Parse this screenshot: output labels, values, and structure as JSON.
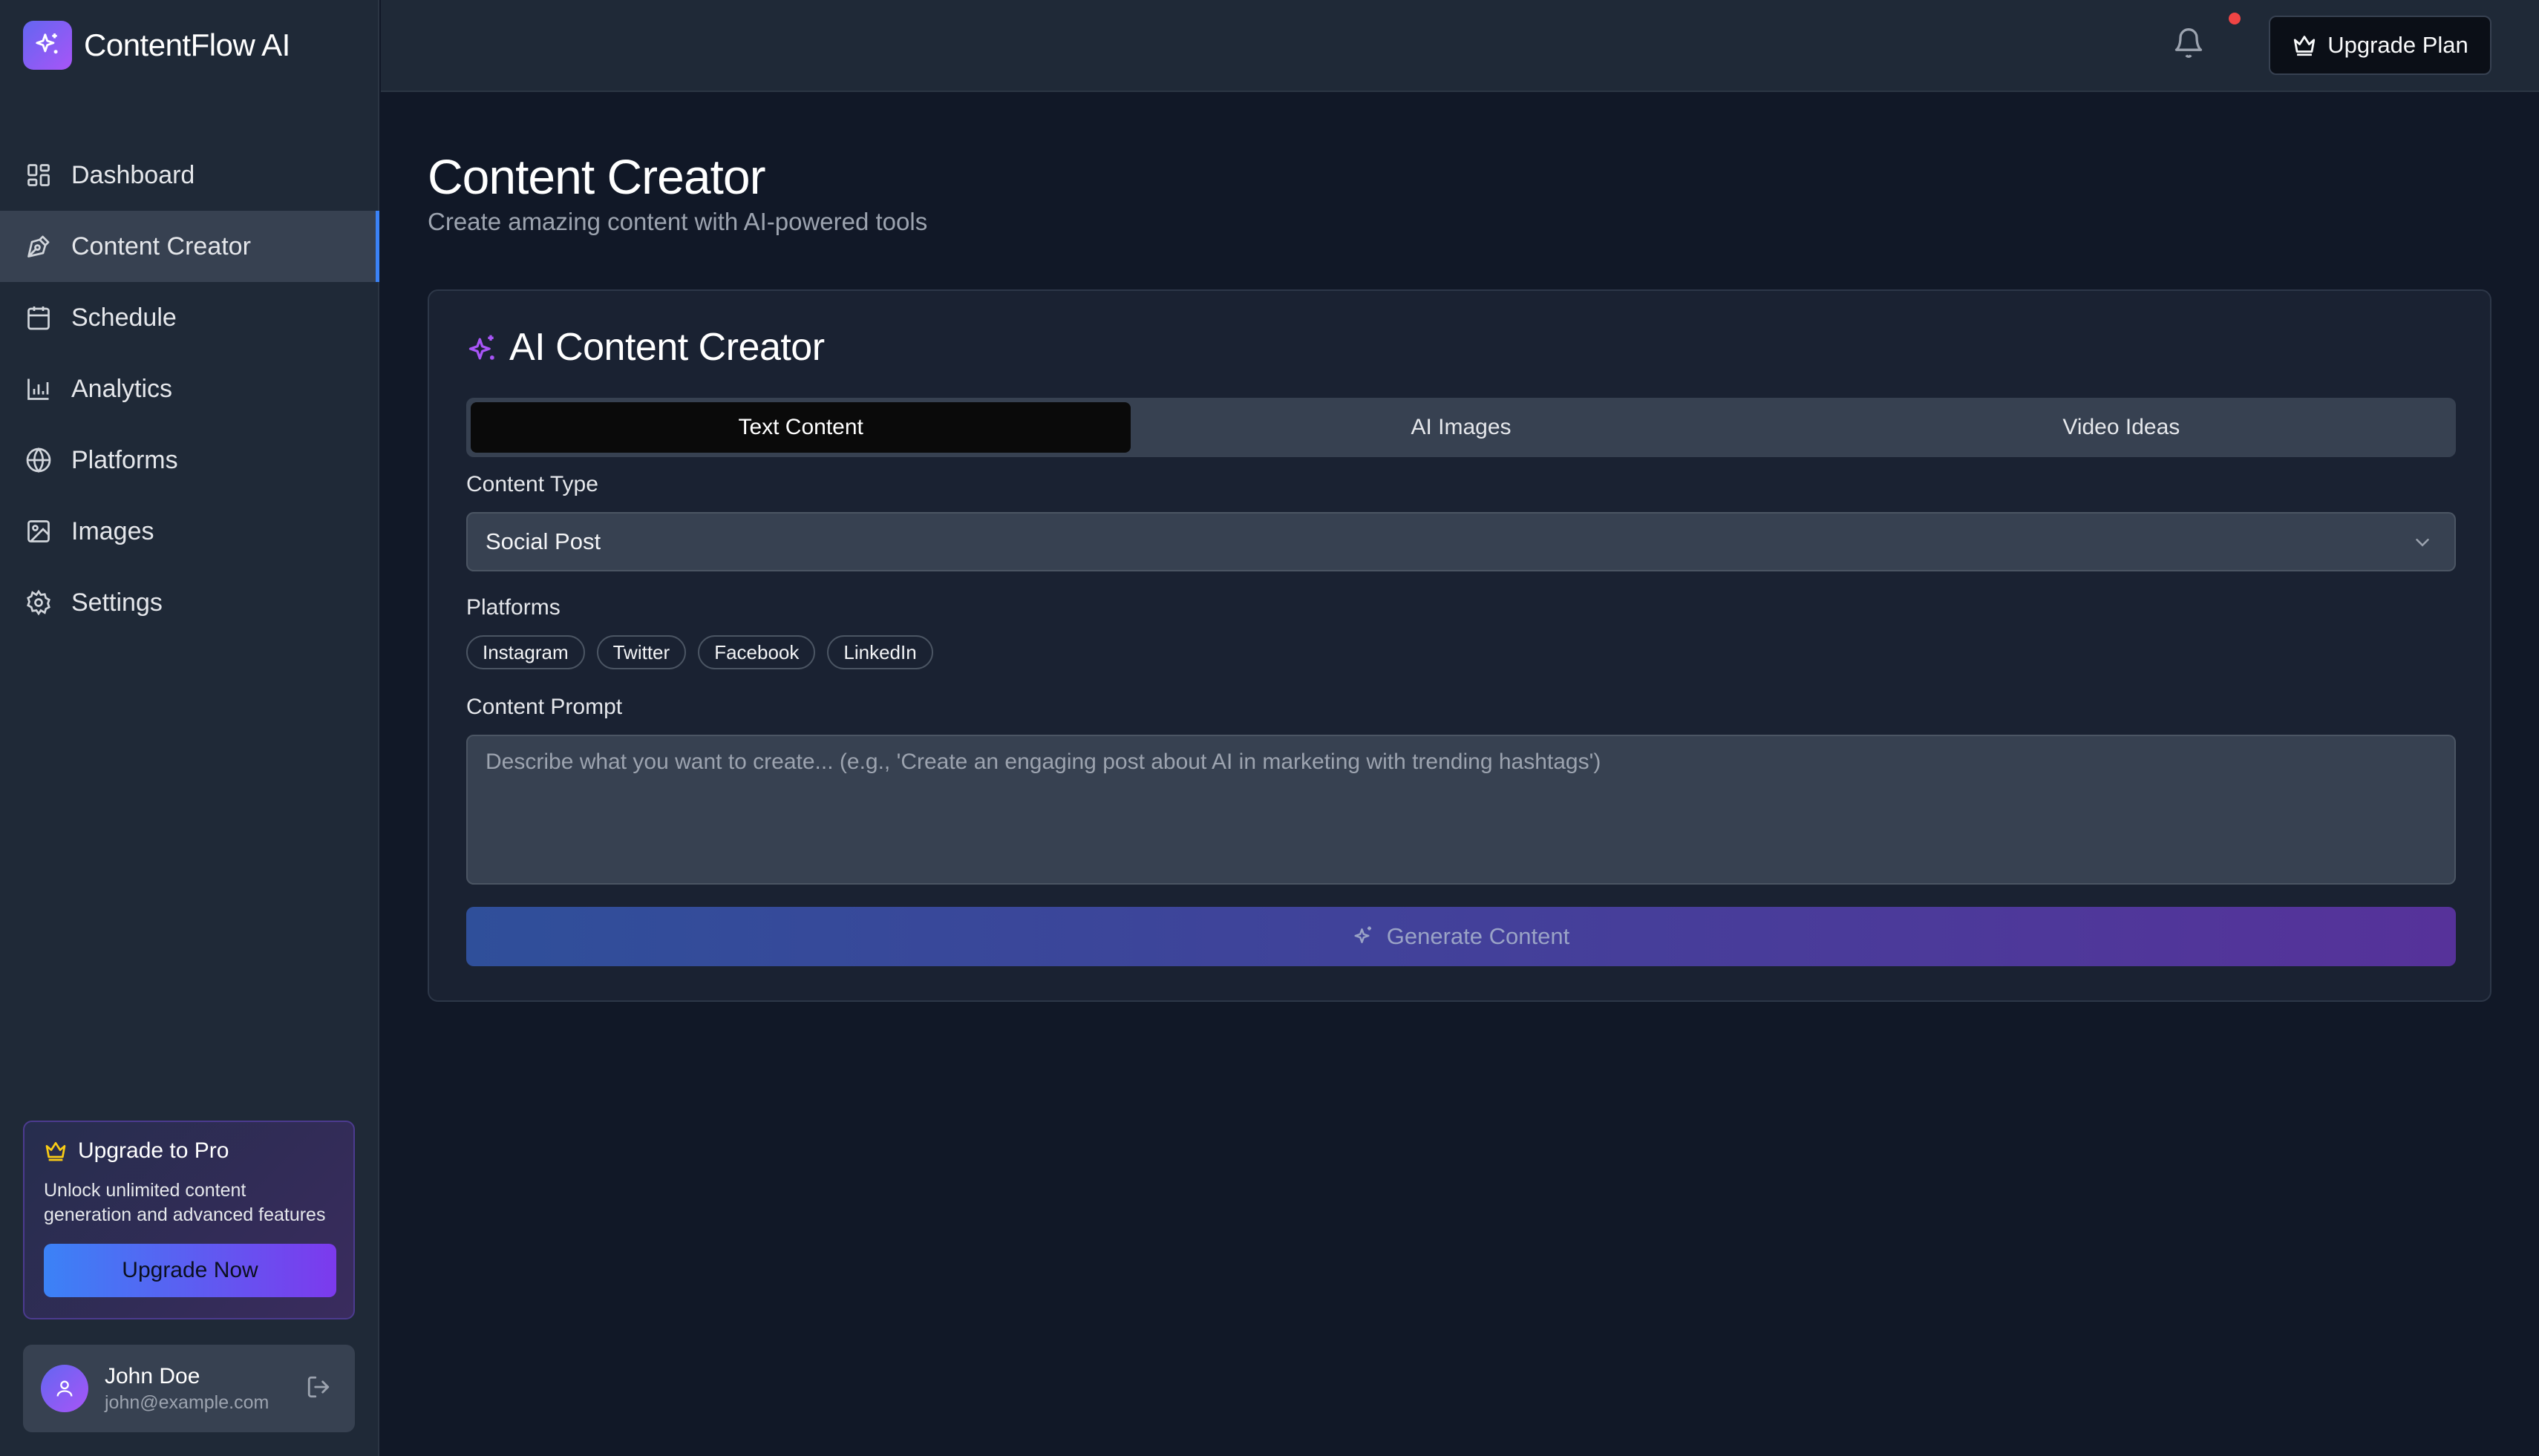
{
  "app": {
    "name": "ContentFlow AI"
  },
  "sidebar": {
    "items": [
      {
        "label": "Dashboard",
        "icon": "dashboard-icon"
      },
      {
        "label": "Content Creator",
        "icon": "pen-tool-icon",
        "active": true
      },
      {
        "label": "Schedule",
        "icon": "calendar-icon"
      },
      {
        "label": "Analytics",
        "icon": "bar-chart-icon"
      },
      {
        "label": "Platforms",
        "icon": "globe-icon"
      },
      {
        "label": "Images",
        "icon": "image-icon"
      },
      {
        "label": "Settings",
        "icon": "gear-icon"
      }
    ],
    "promo": {
      "title": "Upgrade to Pro",
      "text": "Unlock unlimited content generation and advanced features",
      "button": "Upgrade Now"
    },
    "user": {
      "name": "John Doe",
      "email": "john@example.com"
    }
  },
  "topbar": {
    "upgrade_label": "Upgrade Plan",
    "has_notification": true
  },
  "page": {
    "title": "Content Creator",
    "subtitle": "Create amazing content with AI-powered tools"
  },
  "creator": {
    "title": "AI Content Creator",
    "tabs": [
      {
        "label": "Text Content",
        "active": true
      },
      {
        "label": "AI Images"
      },
      {
        "label": "Video Ideas"
      }
    ],
    "content_type_label": "Content Type",
    "content_type_value": "Social Post",
    "platforms_label": "Platforms",
    "platforms": [
      "Instagram",
      "Twitter",
      "Facebook",
      "LinkedIn"
    ],
    "prompt_label": "Content Prompt",
    "prompt_placeholder": "Describe what you want to create... (e.g., 'Create an engaging post about AI in marketing with trending hashtags')",
    "generate_label": "Generate Content"
  },
  "colors": {
    "background": "#111827",
    "sidebar": "#1f2937",
    "accent": "#3b82f6",
    "purple": "#a855f7",
    "notification": "#ef4444"
  }
}
